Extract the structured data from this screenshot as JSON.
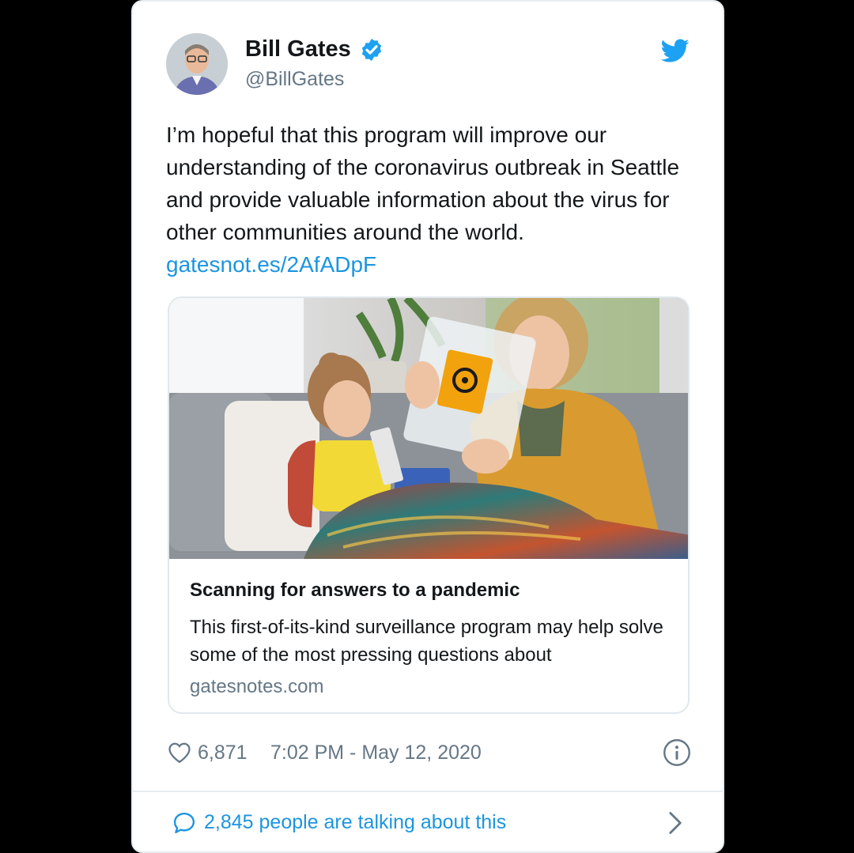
{
  "author": {
    "display_name": "Bill Gates",
    "handle": "@BillGates",
    "verified": true
  },
  "tweet": {
    "text": "I’m hopeful that this program will improve our understanding of the coronavirus outbreak in Seattle and provide valuable information about the virus for other communities around the world.",
    "link": "gatesnot.es/2AfADpF"
  },
  "card": {
    "title": "Scanning for answers to a pandemic",
    "description": "This first-of-its-kind surveillance program may help solve some of the most pressing questions about",
    "domain": "gatesnotes.com"
  },
  "meta": {
    "likes": "6,871",
    "timestamp": "7:02 PM - May 12, 2020"
  },
  "conversation": {
    "label": "2,845 people are talking about this"
  },
  "icons": {
    "brand": "twitter-bird-icon",
    "verified": "verified-badge-icon",
    "like": "heart-icon",
    "info": "info-icon",
    "reply": "speech-bubble-icon",
    "more": "chevron-right-icon"
  },
  "colors": {
    "brand_blue": "#1da1f2",
    "link_blue": "#1b95e0",
    "text": "#14171a",
    "muted": "#657786",
    "border": "#e1e8ed",
    "biohazard_orange": "#f2a20c"
  }
}
